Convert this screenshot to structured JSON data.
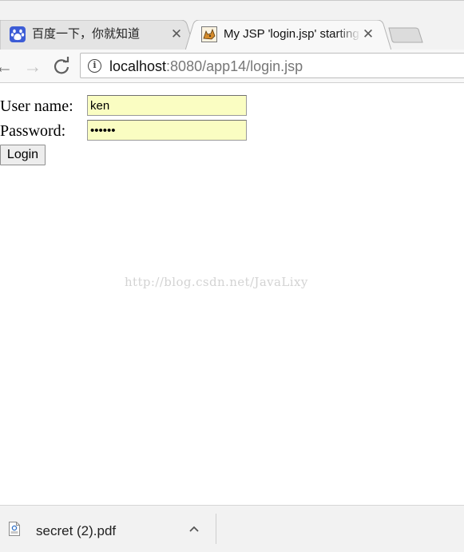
{
  "tabs": [
    {
      "title": "百度一下，你就知道",
      "favicon": "baidu-paw-icon",
      "active": false
    },
    {
      "title": "My JSP 'login.jsp' starting page",
      "favicon": "tomcat-icon",
      "active": true
    }
  ],
  "toolbar": {
    "url_host": "localhost",
    "url_rest": ":8080/app14/login.jsp"
  },
  "form": {
    "username_label": "User name:",
    "username_value": "ken",
    "password_label": "Password:",
    "password_value": "123456",
    "login_label": "Login"
  },
  "watermark": "http://blog.csdn.net/JavaLixy",
  "download": {
    "filename": "secret (2).pdf"
  },
  "colors": {
    "autofill": "#fafdc2",
    "baidu_blue": "#3c5cd6"
  }
}
